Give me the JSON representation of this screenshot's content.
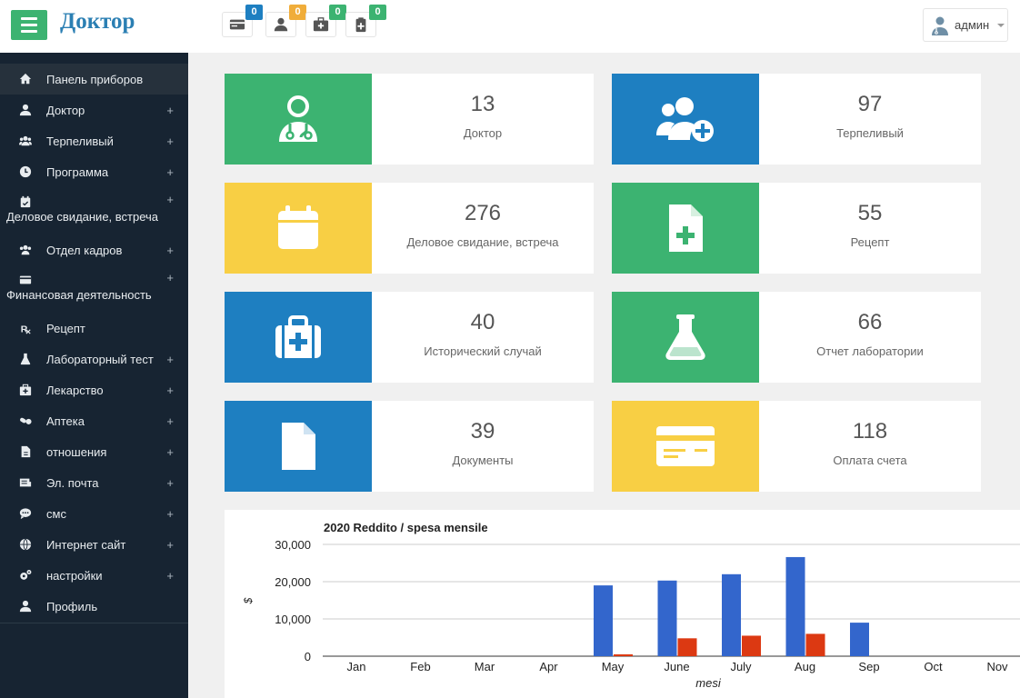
{
  "header": {
    "brand": "Доктор",
    "notifications": [
      {
        "icon": "credit-card-icon",
        "count": "0",
        "color": "#1e7fc1"
      },
      {
        "icon": "user-icon",
        "count": "0",
        "color": "#f0ad3a"
      },
      {
        "icon": "medkit-icon",
        "count": "0",
        "color": "#3cb371"
      },
      {
        "icon": "clipboard-plus-icon",
        "count": "0",
        "color": "#3cb371"
      }
    ],
    "user": {
      "name": "админ",
      "icon": "doctor-avatar-icon"
    }
  },
  "sidebar": {
    "items": [
      {
        "label": "Панель приборов",
        "icon": "home-icon",
        "plus": ""
      },
      {
        "label": "Доктор",
        "icon": "user-md-icon",
        "plus": "+"
      },
      {
        "label": "Терпеливый",
        "icon": "users-icon",
        "plus": "+"
      },
      {
        "label": "Программа",
        "icon": "clock-icon",
        "plus": "+"
      },
      {
        "label": "Деловое свидание, встреча",
        "icon": "calendar-check-icon",
        "plus": "+"
      },
      {
        "label": "Отдел кадров",
        "icon": "users-icon",
        "plus": "+"
      },
      {
        "label": "Финансовая деятельность",
        "icon": "money-icon",
        "plus": "+"
      },
      {
        "label": "Рецепт",
        "icon": "prescription-icon",
        "plus": ""
      },
      {
        "label": "Лабораторный тест",
        "icon": "flask-icon",
        "plus": "+"
      },
      {
        "label": "Лекарство",
        "icon": "medkit-icon",
        "plus": "+"
      },
      {
        "label": "Аптека",
        "icon": "pills-icon",
        "plus": "+"
      },
      {
        "label": "отношения",
        "icon": "file-icon",
        "plus": "+"
      },
      {
        "label": "Эл. почта",
        "icon": "mail-icon",
        "plus": "+"
      },
      {
        "label": "смс",
        "icon": "chat-icon",
        "plus": "+"
      },
      {
        "label": "Интернет сайт",
        "icon": "globe-icon",
        "plus": "+"
      },
      {
        "label": "настройки",
        "icon": "gears-icon",
        "plus": "+"
      },
      {
        "label": "Профиль",
        "icon": "user-icon",
        "plus": ""
      }
    ]
  },
  "cards": [
    {
      "value": "13",
      "label": "Доктор",
      "color": "#3cb371",
      "icon": "doctor-icon"
    },
    {
      "value": "97",
      "label": "Терпеливый",
      "color": "#1e7fc1",
      "icon": "add-users-icon"
    },
    {
      "value": "276",
      "label": "Деловое свидание, встреча",
      "color": "#f8cf44",
      "icon": "calendar-icon"
    },
    {
      "value": "55",
      "label": "Рецепт",
      "color": "#3cb371",
      "icon": "file-medical-icon"
    },
    {
      "value": "40",
      "label": "Исторический случай",
      "color": "#1e7fc1",
      "icon": "medkit-icon"
    },
    {
      "value": "66",
      "label": "Отчет лаборатории",
      "color": "#3cb371",
      "icon": "flask-icon"
    },
    {
      "value": "39",
      "label": "Документы",
      "color": "#1e7fc1",
      "icon": "file-icon"
    },
    {
      "value": "118",
      "label": "Оплата счета",
      "color": "#f8cf44",
      "icon": "credit-card-icon"
    }
  ],
  "chart_data": {
    "type": "bar",
    "title": "2020 Reddito / spesa mensile",
    "xlabel": "mesi",
    "ylabel": "$",
    "ylim": [
      0,
      30000
    ],
    "yticks": [
      "0",
      "10,000",
      "20,000",
      "30,000"
    ],
    "grid": true,
    "categories": [
      "Jan",
      "Feb",
      "Mar",
      "Apr",
      "May",
      "June",
      "July",
      "Aug",
      "Sep",
      "Oct",
      "Nov"
    ],
    "series": [
      {
        "values": [
          0,
          0,
          0,
          0,
          19000,
          20300,
          22000,
          26600,
          9000,
          0,
          0
        ],
        "color": "#3366cc"
      },
      {
        "values": [
          0,
          0,
          0,
          0,
          500,
          4800,
          5500,
          6000,
          0,
          0,
          0
        ],
        "color": "#dc3912"
      }
    ]
  }
}
